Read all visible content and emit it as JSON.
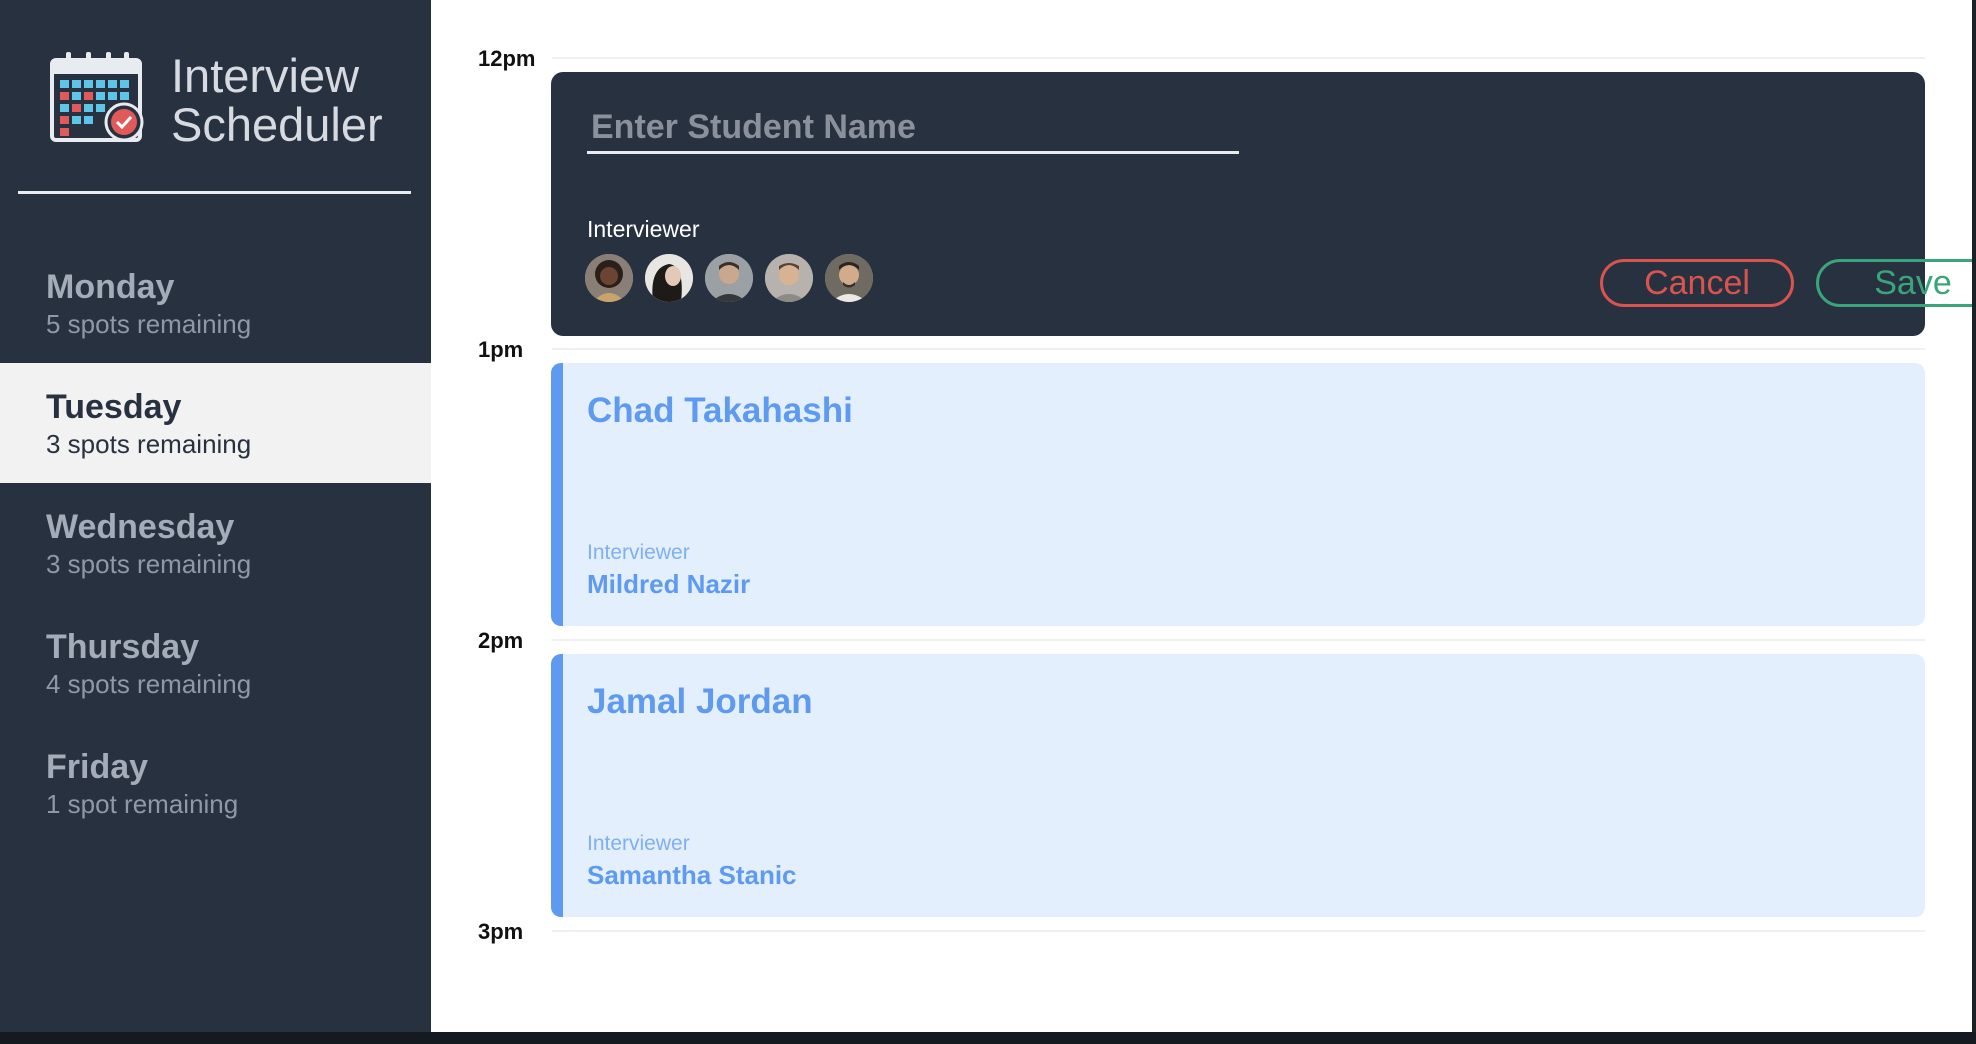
{
  "app": {
    "title_line1": "Interview",
    "title_line2": "Scheduler"
  },
  "sidebar": {
    "days": [
      {
        "name": "Monday",
        "spots": "5 spots remaining",
        "selected": false
      },
      {
        "name": "Tuesday",
        "spots": "3 spots remaining",
        "selected": true
      },
      {
        "name": "Wednesday",
        "spots": "3 spots remaining",
        "selected": false
      },
      {
        "name": "Thursday",
        "spots": "4 spots remaining",
        "selected": false
      },
      {
        "name": "Friday",
        "spots": "1 spot remaining",
        "selected": false
      }
    ]
  },
  "schedule": {
    "times": [
      "12pm",
      "1pm",
      "2pm",
      "3pm"
    ],
    "form": {
      "student_placeholder": "Enter Student Name",
      "student_value": "",
      "interviewer_label": "Interviewer",
      "interviewers": [
        {
          "icon": "interviewer-avatar-1"
        },
        {
          "icon": "interviewer-avatar-2"
        },
        {
          "icon": "interviewer-avatar-3"
        },
        {
          "icon": "interviewer-avatar-4"
        },
        {
          "icon": "interviewer-avatar-5"
        }
      ],
      "cancel_label": "Cancel",
      "save_label": "Save"
    },
    "appointments": [
      {
        "student": "Chad Takahashi",
        "interviewer_label": "Interviewer",
        "interviewer": "Mildred Nazir"
      },
      {
        "student": "Jamal Jordan",
        "interviewer_label": "Interviewer",
        "interviewer": "Samantha Stanic"
      }
    ]
  },
  "colors": {
    "sidebar_bg": "#283140",
    "selected_day_bg": "#f2f2f2",
    "cancel": "#d9534f",
    "save": "#3aa57a",
    "appointment_accent": "#5e9af0",
    "appointment_bg": "#e4effd"
  }
}
